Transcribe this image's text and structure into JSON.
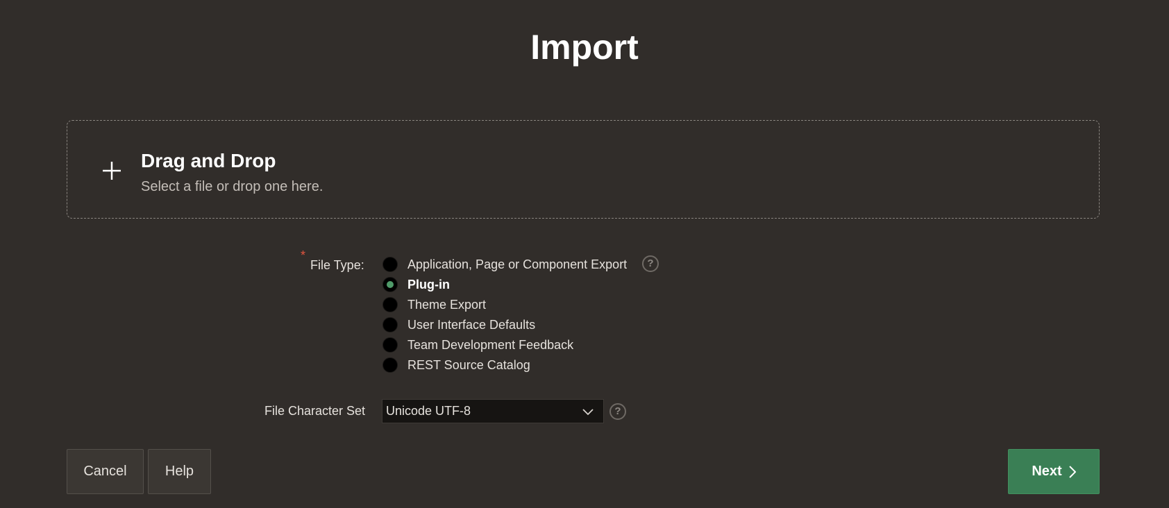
{
  "page": {
    "title": "Import"
  },
  "dropzone": {
    "title": "Drag and Drop",
    "subtitle": "Select a file or drop one here.",
    "icon": "plus-icon"
  },
  "file_type": {
    "required_mark": "*",
    "label": "File Type:",
    "selected": "Plug-in",
    "options": [
      {
        "label": "Application, Page or Component Export",
        "checked": false
      },
      {
        "label": "Plug-in",
        "checked": true
      },
      {
        "label": "Theme Export",
        "checked": false
      },
      {
        "label": "User Interface Defaults",
        "checked": false
      },
      {
        "label": "Team Development Feedback",
        "checked": false
      },
      {
        "label": "REST Source Catalog",
        "checked": false
      }
    ],
    "help_icon": "?"
  },
  "charset": {
    "label": "File Character Set",
    "value": "Unicode UTF-8",
    "help_icon": "?"
  },
  "buttons": {
    "cancel": "Cancel",
    "help": "Help",
    "next": "Next"
  },
  "colors": {
    "background": "#312d2a",
    "primary": "#3a7f55",
    "required": "#e2553f",
    "radio_selected": "#4f9a69"
  }
}
